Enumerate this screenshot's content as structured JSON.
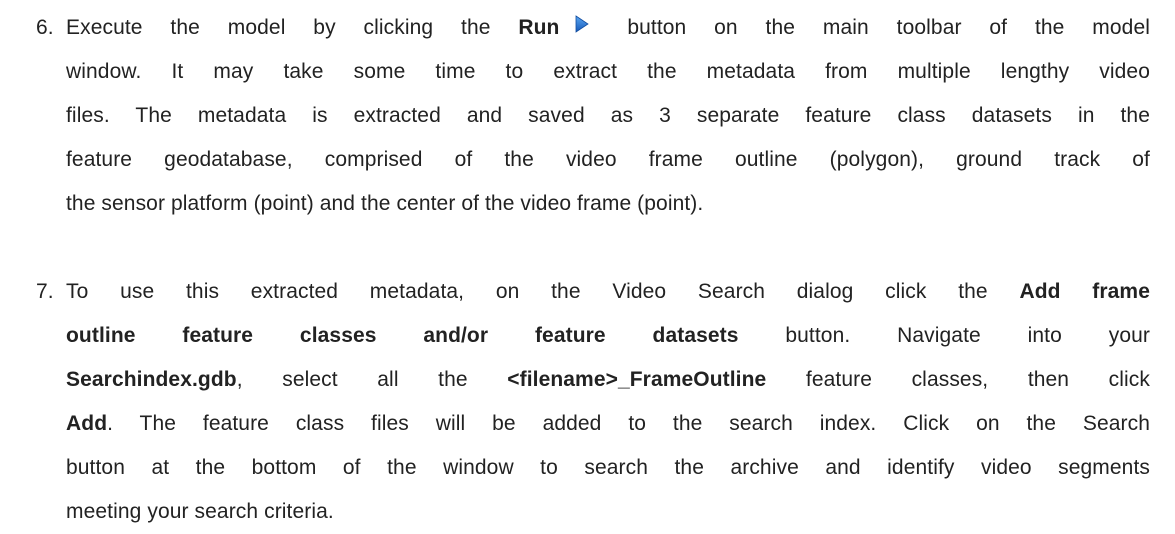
{
  "document": {
    "step6": {
      "number": "6.",
      "l1_pre": "Execute the model by clicking the ",
      "l1_bold": "Run",
      "l1_post": " button on the main toolbar of the model",
      "l2": "window. It may take some time to extract the metadata from multiple lengthy video",
      "l3": "files. The metadata is extracted and saved as 3 separate feature class datasets in the",
      "l4": "feature geodatabase, comprised of the video frame outline (polygon), ground track of",
      "l5": "the sensor platform (point) and the center of the video frame (point).",
      "run_icon": "run-play-icon"
    },
    "step7": {
      "number": "7.",
      "l1_pre": "To use this extracted metadata, on the Video Search dialog click the ",
      "l1_bold": "Add frame",
      "l2_bold": "outline feature classes and/or feature datasets",
      "l2_post": " button. Navigate into your",
      "l3_bold1": "Searchindex.gdb",
      "l3_mid": ", select all the ",
      "l3_bold2": "<filename>_FrameOutline",
      "l3_post": " feature classes, then click",
      "l4_bold": "Add",
      "l4_post": ". The feature class files will be added to the search index. Click on the Search",
      "l5": "button at the bottom of the window to search the archive and identify video segments",
      "l6": "meeting your search criteria."
    }
  },
  "colors": {
    "text": "#222222",
    "icon_blue": "#1f6fd1"
  }
}
